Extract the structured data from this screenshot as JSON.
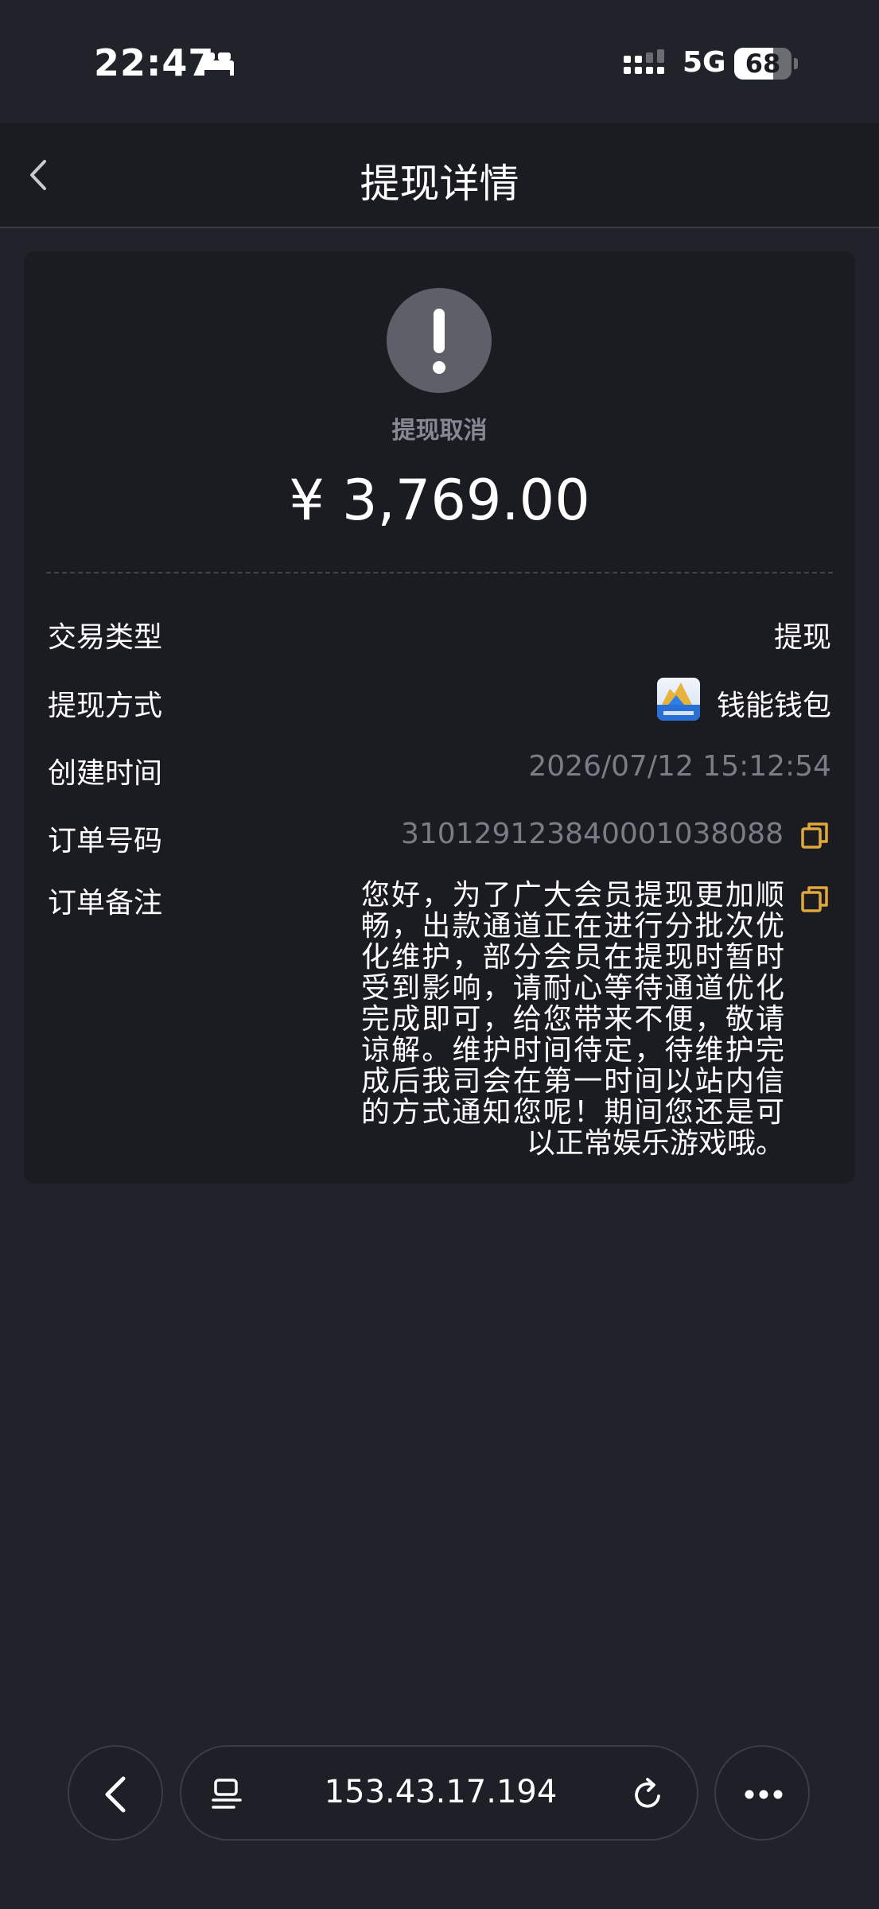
{
  "status_bar": {
    "time": "22:47",
    "network": "5G",
    "battery": "68",
    "battery_level": 0.68
  },
  "nav": {
    "title": "提现详情"
  },
  "summary": {
    "status": "提现取消",
    "amount": "¥ 3,769.00"
  },
  "details": {
    "type_label": "交易类型",
    "type_value": "提现",
    "method_label": "提现方式",
    "method_value": "钱能钱包",
    "created_label": "创建时间",
    "created_value": "2026/07/12 15:12:54",
    "order_label": "订单号码",
    "order_value": "31012912384000103808​8",
    "note_label": "订单备注",
    "note_value": "您好，为了广大会员提现更加顺畅，出款通道正在进行分批次优化维护，部分会员在提现时暂时受到影响，请耐心等待通道优化完成即可，给您带来不便，敬请谅解。维护时间待定，待维护完成后我司会在第一时间以站内信的方式通知您呢！期间您还是可以正常娱乐游戏哦。"
  },
  "browser": {
    "url": "153.43.17.194"
  },
  "colors": {
    "background": "#21232b",
    "card": "#1b1c22",
    "accent_copy": "#e0a93a",
    "muted_text": "#7b7d86"
  }
}
